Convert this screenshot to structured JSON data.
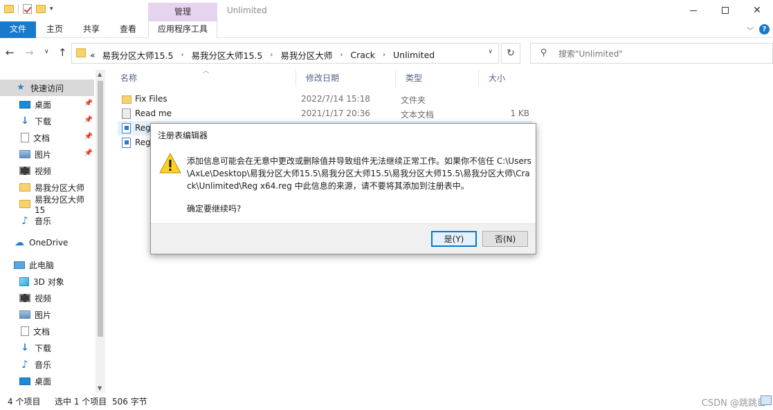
{
  "window": {
    "title": "Unlimited",
    "contextual_tab_group": "管理"
  },
  "ribbon": {
    "tabs": [
      {
        "label": "文件"
      },
      {
        "label": "主页"
      },
      {
        "label": "共享"
      },
      {
        "label": "查看"
      },
      {
        "label": "应用程序工具"
      }
    ]
  },
  "address": {
    "overflow": "«",
    "crumbs": [
      "易我分区大师15.5",
      "易我分区大师15.5",
      "易我分区大师",
      "Crack",
      "Unlimited"
    ]
  },
  "search": {
    "placeholder": "搜索\"Unlimited\""
  },
  "sidebar": {
    "items": [
      {
        "label": "快速访问",
        "icon": "star-icon",
        "selected": true,
        "pinned": false
      },
      {
        "label": "桌面",
        "icon": "desktop-icon",
        "pinned": true
      },
      {
        "label": "下载",
        "icon": "download-icon",
        "pinned": true
      },
      {
        "label": "文档",
        "icon": "document-icon",
        "pinned": true
      },
      {
        "label": "图片",
        "icon": "pictures-icon",
        "pinned": true
      },
      {
        "label": "视频",
        "icon": "video-icon",
        "pinned": false
      },
      {
        "label": "易我分区大师",
        "icon": "folder-icon",
        "pinned": false
      },
      {
        "label": "易我分区大师15",
        "icon": "folder-icon",
        "pinned": false
      },
      {
        "label": "音乐",
        "icon": "music-icon",
        "pinned": false
      },
      {
        "label": "OneDrive",
        "icon": "cloud-icon",
        "pinned": false
      },
      {
        "label": "此电脑",
        "icon": "computer-icon",
        "pinned": false
      },
      {
        "label": "3D 对象",
        "icon": "3d-objects-icon",
        "pinned": false
      },
      {
        "label": "视频",
        "icon": "video-icon",
        "pinned": false
      },
      {
        "label": "图片",
        "icon": "pictures-icon",
        "pinned": false
      },
      {
        "label": "文档",
        "icon": "document-icon",
        "pinned": false
      },
      {
        "label": "下载",
        "icon": "download-icon",
        "pinned": false
      },
      {
        "label": "音乐",
        "icon": "music-icon",
        "pinned": false
      },
      {
        "label": "桌面",
        "icon": "desktop-icon",
        "pinned": false
      }
    ]
  },
  "columns": {
    "name": "名称",
    "date": "修改日期",
    "type": "类型",
    "size": "大小"
  },
  "files": [
    {
      "name": "Fix Files",
      "date": "2022/7/14 15:18",
      "type": "文件夹",
      "size": "",
      "icon": "folder-icon"
    },
    {
      "name": "Read me",
      "date": "2021/1/17 20:36",
      "type": "文本文档",
      "size": "1 KB",
      "icon": "text-file-icon"
    },
    {
      "name": "Reg",
      "date": "",
      "type": "",
      "size": "",
      "icon": "registry-file-icon",
      "selected": true
    },
    {
      "name": "Reg",
      "date": "",
      "type": "",
      "size": "",
      "icon": "registry-file-icon"
    }
  ],
  "status": {
    "item_count": "4 个项目",
    "selection": "选中 1 个项目",
    "size": "506 字节"
  },
  "watermark": "CSDN @跳跳目",
  "dialog": {
    "title": "注册表编辑器",
    "message": "添加信息可能会在无意中更改或删除值并导致组件无法继续正常工作。如果你不信任 C:\\Users\\AxLe\\Desktop\\易我分区大师15.5\\易我分区大师15.5\\易我分区大师15.5\\易我分区大师\\Crack\\Unlimited\\Reg x64.reg 中此信息的来源，请不要将其添加到注册表中。",
    "confirm": "确定要继续吗?",
    "yes_label": "是(Y)",
    "no_label": "否(N)"
  }
}
